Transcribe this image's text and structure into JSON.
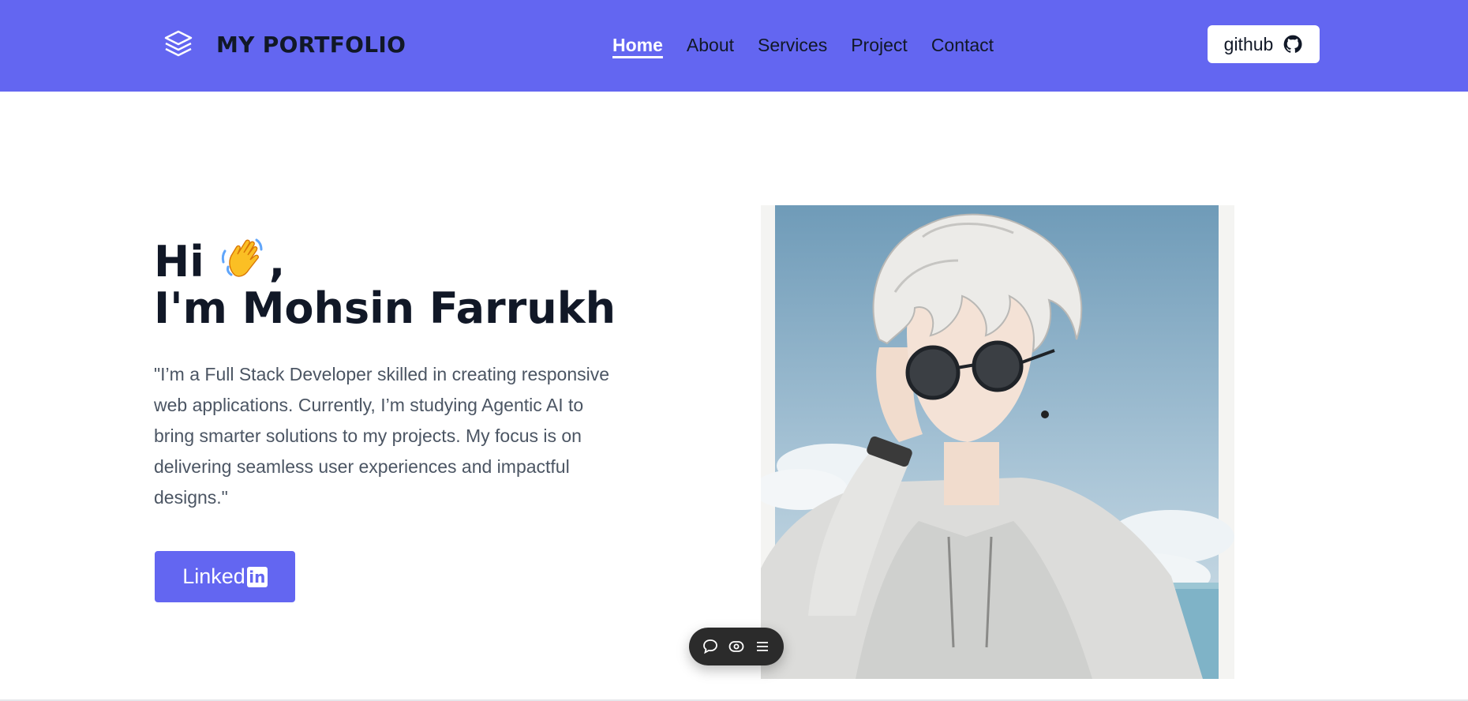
{
  "header": {
    "brand_icon": "layers-icon",
    "brand_text": "MY PORTFOLIO",
    "nav": [
      {
        "label": "Home",
        "active": true
      },
      {
        "label": "About",
        "active": false
      },
      {
        "label": "Services",
        "active": false
      },
      {
        "label": "Project",
        "active": false
      },
      {
        "label": "Contact",
        "active": false
      }
    ],
    "github_label": "github",
    "github_icon": "github-icon"
  },
  "hero": {
    "greeting": "Hi",
    "greeting_suffix": ",",
    "wave_icon": "waving-hand-icon",
    "name": "I'm Mohsin Farrukh",
    "bio": "\"I’m a Full Stack Developer skilled in creating responsive web applications. Currently, I’m studying Agentic AI to bring smarter solutions to my projects. My focus is on delivering seamless user experiences and impactful designs.\"",
    "linkedin_label": "Linked",
    "linkedin_icon_text": "in",
    "portrait_image": "anime-character-portrait"
  },
  "toolbar": {
    "icons": [
      "comment-icon",
      "eye-icon",
      "menu-icon"
    ]
  },
  "colors": {
    "primary": "#6366f1",
    "text": "#111827",
    "muted": "#4b5563",
    "toolbar": "#2b2b2b"
  }
}
